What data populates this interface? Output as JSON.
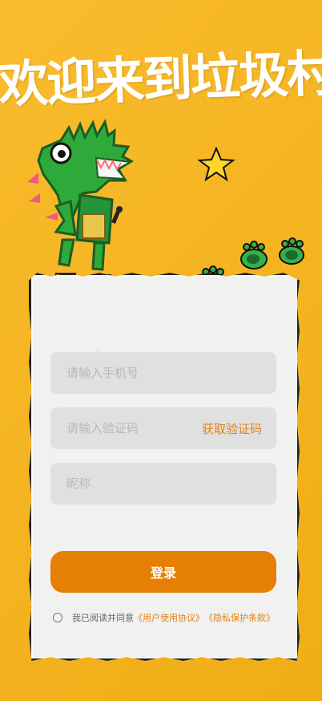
{
  "header": {
    "title": "欢迎来到垃圾村"
  },
  "form": {
    "phone_placeholder": "请输入手机号",
    "code_placeholder": "请输入验证码",
    "get_code_label": "获取验证码",
    "nickname_placeholder": "昵称",
    "login_label": "登录"
  },
  "agreement": {
    "prefix": "我已阅读并同意",
    "user_agreement": "《用户使用协议》",
    "privacy_policy": "《隐私保护条款》"
  },
  "colors": {
    "background": "#f9b416",
    "accent": "#e57f05",
    "link": "#e18215",
    "input_bg": "#e0e0e0",
    "card_bg": "#f1f1ef"
  }
}
